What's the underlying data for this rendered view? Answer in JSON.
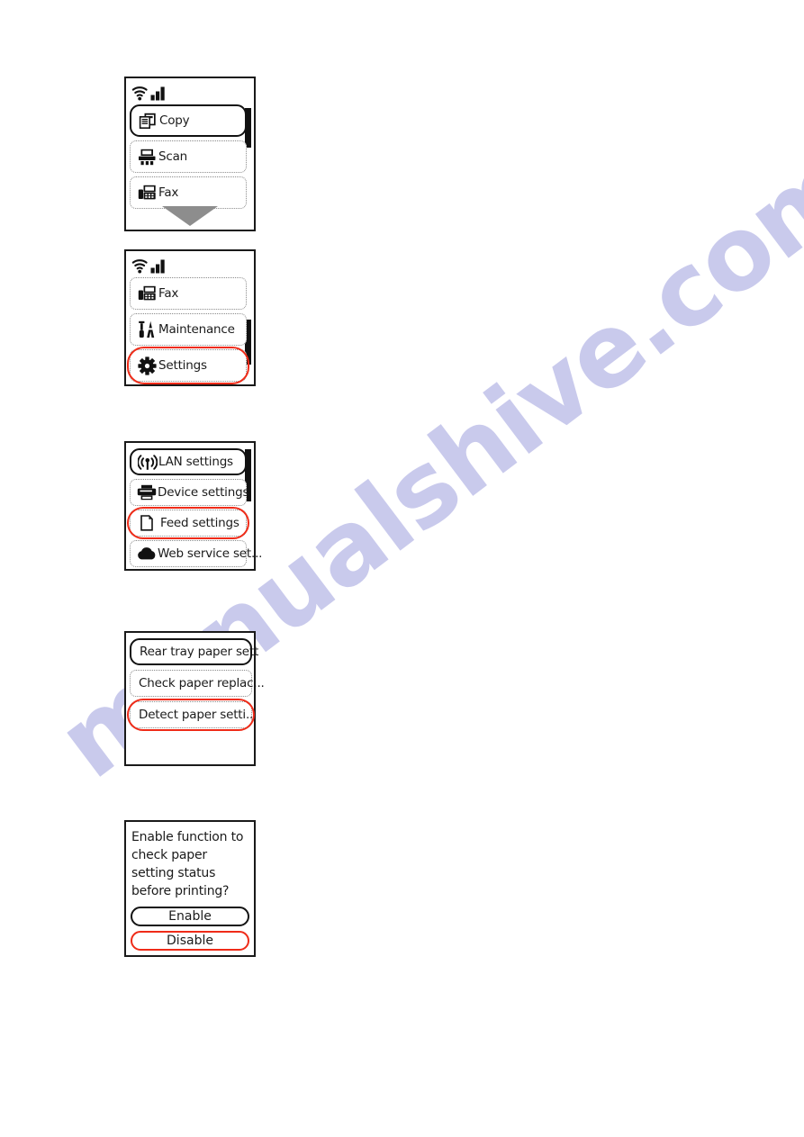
{
  "page": {
    "watermark": "manualshive.com",
    "background_color": "#ffffff"
  },
  "colors": {
    "selection_red": "#ef2b18",
    "selection_black": "#121212",
    "row_border": "#8a8a8a",
    "arrow_gray": "#8d8d8d",
    "watermark": "#c7c8ec"
  },
  "screens": [
    {
      "id": "home-menu-top",
      "statusbar": {
        "wifi_icon": "wifi-icon",
        "signal_icon": "signal-bars-icon"
      },
      "scroll": {
        "thumb_top_pct": 5,
        "thumb_height_pct": 46
      },
      "arrow": {
        "icon": "arrow-down-icon",
        "color": "#8d8d8d"
      },
      "rows": [
        {
          "icon": "copy-icon",
          "label": "Copy",
          "selection": "black"
        },
        {
          "icon": "scan-icon",
          "label": "Scan",
          "selection": "none"
        },
        {
          "icon": "fax-icon",
          "label": "Fax",
          "selection": "none"
        }
      ]
    },
    {
      "id": "home-menu-bottom",
      "statusbar": {
        "wifi_icon": "wifi-icon",
        "signal_icon": "signal-bars-icon"
      },
      "scroll": {
        "thumb_top_pct": 50,
        "thumb_height_pct": 46
      },
      "rows": [
        {
          "icon": "fax-icon",
          "label": "Fax",
          "selection": "none"
        },
        {
          "icon": "maintenance-icon",
          "label": "Maintenance",
          "selection": "none"
        },
        {
          "icon": "gear-icon",
          "label": "Settings",
          "selection": "red"
        }
      ]
    },
    {
      "id": "settings-menu",
      "scroll": {
        "thumb_top_pct": 2,
        "thumb_height_pct": 45
      },
      "rows": [
        {
          "icon": "lan-icon",
          "label": "LAN settings",
          "selection": "black"
        },
        {
          "icon": "printer-icon",
          "label": "Device settings",
          "selection": "none"
        },
        {
          "icon": "paper-feed-icon",
          "label": "Feed settings",
          "selection": "red"
        },
        {
          "icon": "cloud-icon",
          "label": "Web service set...",
          "selection": "none"
        }
      ]
    },
    {
      "id": "feed-settings-menu",
      "rows": [
        {
          "icon": "none",
          "label": "Rear tray paper sett",
          "selection": "black"
        },
        {
          "icon": "none",
          "label": "Check paper replac...",
          "selection": "none"
        },
        {
          "icon": "none",
          "label": "Detect paper setti...",
          "selection": "red"
        }
      ]
    },
    {
      "id": "detect-paper-setting-dialog",
      "message": "Enable function to check paper setting status before printing?",
      "buttons": [
        {
          "label": "Enable",
          "selection": "black"
        },
        {
          "label": "Disable",
          "selection": "red"
        }
      ]
    }
  ]
}
